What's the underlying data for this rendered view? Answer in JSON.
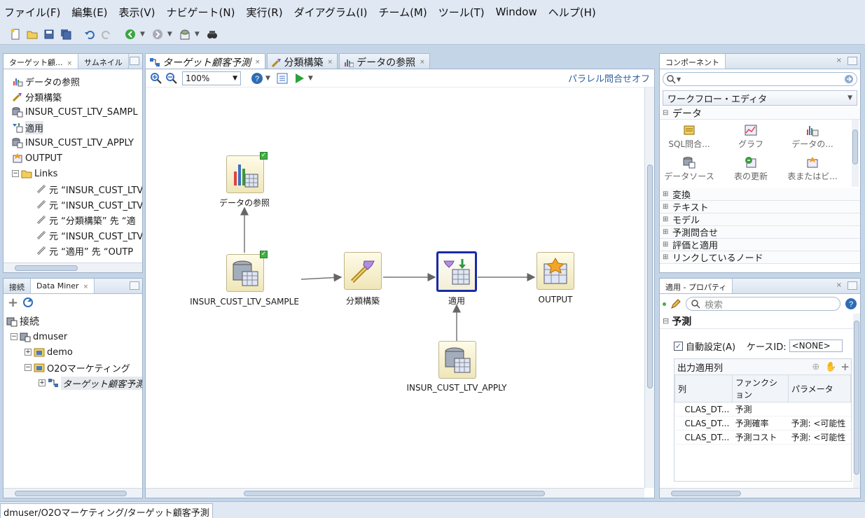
{
  "menu": [
    "ファイル(F)",
    "編集(E)",
    "表示(V)",
    "ナビゲート(N)",
    "実行(R)",
    "ダイアグラム(I)",
    "チーム(M)",
    "ツール(T)",
    "Window",
    "ヘルプ(H)"
  ],
  "left_top": {
    "tabs": [
      "ターゲット顧...",
      "サムネイル"
    ],
    "items": [
      {
        "label": "データの参照"
      },
      {
        "label": "分類構築"
      },
      {
        "label": "INSUR_CUST_LTV_SAMPL"
      },
      {
        "label": "適用"
      },
      {
        "label": "INSUR_CUST_LTV_APPLY"
      },
      {
        "label": "OUTPUT"
      },
      {
        "label": "Links"
      },
      {
        "label": "元 “INSUR_CUST_LTV"
      },
      {
        "label": "元 “INSUR_CUST_LTV"
      },
      {
        "label": "元 “分類構築” 先 “適"
      },
      {
        "label": "元 “INSUR_CUST_LTV"
      },
      {
        "label": "元 “適用” 先 “OUTP"
      }
    ]
  },
  "left_bottom": {
    "tabs": [
      "接続",
      "Data Miner"
    ],
    "items": [
      {
        "label": "接続"
      },
      {
        "label": "dmuser"
      },
      {
        "label": "demo"
      },
      {
        "label": "O2Oマーケティング"
      },
      {
        "label": "ターゲット顧客予測"
      }
    ]
  },
  "editor": {
    "tabs": [
      "ターゲット顧客予測",
      "分類構築",
      "データの参照"
    ],
    "zoom": "100%",
    "parallel_link": "パラレル問合せオフ",
    "nodes": {
      "data_view": "データの参照",
      "sample": "INSUR_CUST_LTV_SAMPLE",
      "build": "分類構築",
      "apply": "適用",
      "output": "OUTPUT",
      "apply_data": "INSUR_CUST_LTV_APPLY"
    }
  },
  "components": {
    "title": "コンポーネント",
    "dropdown": "ワークフロー・エディタ",
    "section_data": "データ",
    "items": [
      "SQL問合...",
      "グラフ",
      "データの...",
      "データソース",
      "表の更新",
      "表またはビ..."
    ],
    "categories": [
      "変換",
      "テキスト",
      "モデル",
      "予測問合せ",
      "評価と適用",
      "リンクしているノード"
    ]
  },
  "properties": {
    "title": "適用 - プロパティ",
    "search_placeholder": "検索",
    "section": "予測",
    "auto_label": "自動設定(A)",
    "case_id_label": "ケースID:",
    "case_id_value": "<NONE>",
    "output_cols_label": "出力適用列",
    "headers": [
      "列",
      "ファンクション",
      "パラメータ"
    ],
    "rows": [
      [
        "CLAS_DT...",
        "予測",
        ""
      ],
      [
        "CLAS_DT...",
        "予測確率",
        "予測: <可能性"
      ],
      [
        "CLAS_DT...",
        "予測コスト",
        "予測: <可能性"
      ]
    ]
  },
  "status": "dmuser/O2Oマーケティング/ターゲット顧客予測",
  "colors": {
    "selected_border": "#1a2aa8",
    "link": "#2f5fa0",
    "check": "#41b043"
  }
}
